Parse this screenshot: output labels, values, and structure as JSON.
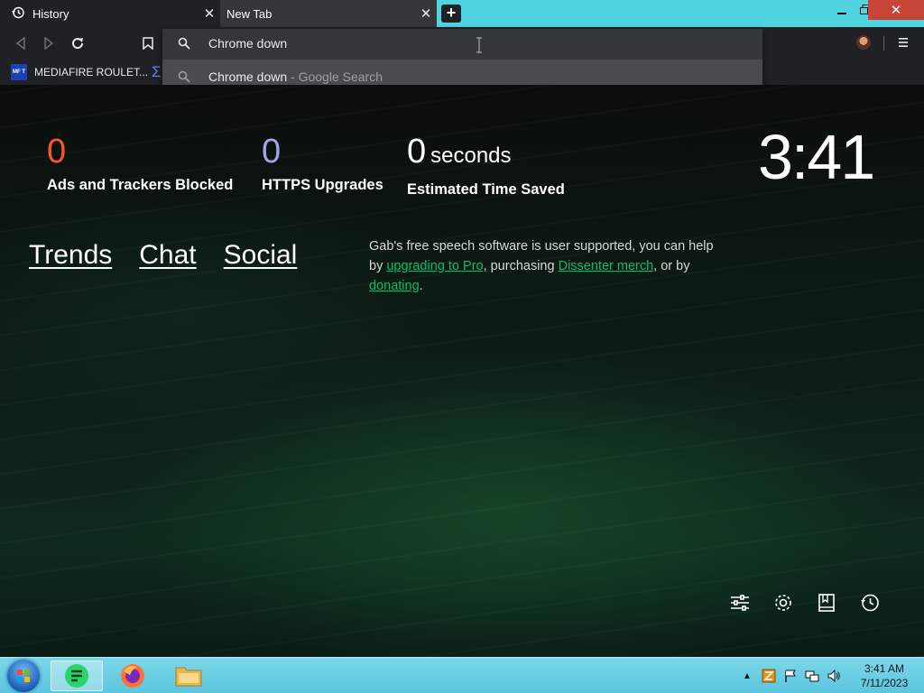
{
  "tabs": [
    {
      "title": "History",
      "icon": "history-icon"
    },
    {
      "title": "New Tab",
      "icon": ""
    }
  ],
  "window": {
    "close_glyph": "✕",
    "newtab_glyph": "+"
  },
  "omnibox": {
    "query": "Chrome down",
    "suggestion_text": "Chrome down",
    "suggestion_suffix": " - Google Search"
  },
  "bookmarks": [
    {
      "label": "MEDIAFIRE ROULET...",
      "favicon_text": "MF T"
    }
  ],
  "stats": {
    "ads": {
      "value": "0",
      "label": "Ads and Trackers Blocked",
      "color": "#fb542b"
    },
    "https": {
      "value": "0",
      "label": "HTTPS Upgrades",
      "color": "#a0a5eb"
    },
    "time": {
      "value": "0",
      "unit": "seconds",
      "label": "Estimated Time Saved"
    }
  },
  "clock": "3:41",
  "top_links": [
    "Trends",
    "Chat",
    "Social"
  ],
  "gab": {
    "text1": "Gab's free speech software is user supported, you can help by ",
    "link1": "upgrading to Pro",
    "text2": ", purchasing ",
    "link2": "Dissenter merch",
    "text3": ", or by ",
    "link3": "donating",
    "text4": "."
  },
  "page_icons": [
    "customize-icon",
    "settings-icon",
    "bookmarks-icon",
    "history-icon"
  ],
  "taskbar": {
    "time": "3:41 AM",
    "date": "7/11/2023",
    "apps": [
      "notes-app-icon",
      "firefox-icon",
      "file-explorer-icon"
    ]
  },
  "colors": {
    "tab_strip": "#4fd4e0",
    "accent_link": "#00c26a",
    "close_button": "#c74536"
  }
}
